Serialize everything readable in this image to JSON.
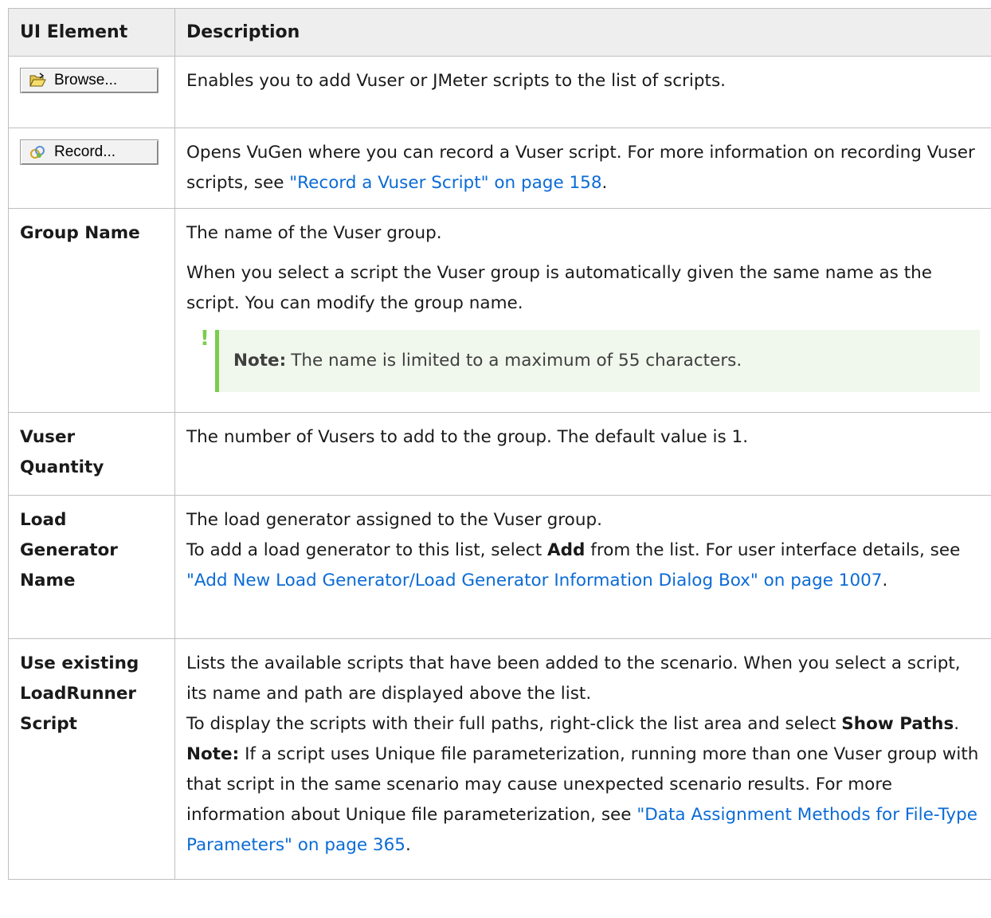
{
  "header": {
    "col1": "UI Element",
    "col2": "Description"
  },
  "rows": {
    "browse": {
      "button_label": "Browse...",
      "icon": "folder-open-icon",
      "desc": "Enables you to add Vuser or JMeter scripts to the list of scripts."
    },
    "record": {
      "button_label": "Record...",
      "icon": "record-icon",
      "desc_pre": "Opens VuGen where you can record a Vuser script. For more information on recording Vuser scripts, see ",
      "link": "\"Record a Vuser Script\" on page 158",
      "desc_post": "."
    },
    "group_name": {
      "element": "Group Name",
      "desc1": "The name of the Vuser group.",
      "desc2": "When you select a script the Vuser group is automatically given the same name as the script. You can modify the group name.",
      "note_bang": "!",
      "note_label": "Note:",
      "note_text": "The name is limited to a maximum of 55 characters."
    },
    "vuser_quantity": {
      "element": "Vuser Quantity",
      "desc": "The number of Vusers to add to the group. The default value is 1."
    },
    "load_generator": {
      "element": "Load Generator Name",
      "line1": "The load generator assigned to the Vuser group.",
      "line2_pre": "To add a load generator to this list, select ",
      "line2_bold": "Add",
      "line2_post": " from the list. For user interface details, see ",
      "link": "\"Add New Load Generator/Load Generator Information Dialog Box\" on page 1007",
      "line2_end": "."
    },
    "use_existing": {
      "element": "Use existing LoadRunner Script",
      "line1": "Lists the available scripts that have been added to the scenario. When you select a script, its name and path are displayed above the list.",
      "line2_pre": "To display the scripts with their full paths, right-click the list area and select ",
      "line2_bold": "Show Paths",
      "line2_post": ".",
      "note_label": "Note:",
      "note_text": " If a script uses Unique file parameterization, running more than one Vuser group with that script in the same scenario may cause unexpected scenario results. For more information about Unique file parameterization, see ",
      "link": "\"Data Assignment Methods for File-Type Parameters\" on page 365",
      "end": "."
    }
  },
  "colors": {
    "link": "#0b6bd6",
    "note_bar": "#7ccd4f",
    "note_bg": "#f0f7ec",
    "header_bg": "#eeeeee",
    "border": "#bfbfbf"
  }
}
